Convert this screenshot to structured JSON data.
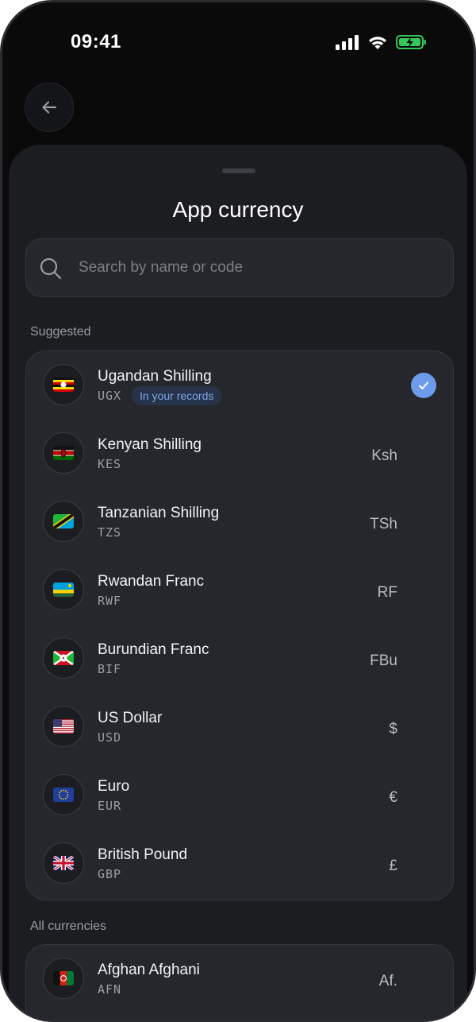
{
  "status_bar": {
    "time": "09:41"
  },
  "sheet": {
    "title": "App currency",
    "search": {
      "placeholder": "Search by name or code",
      "value": ""
    }
  },
  "sections": {
    "suggested_label": "Suggested",
    "all_label": "All currencies"
  },
  "suggested": [
    {
      "name": "Ugandan Shilling",
      "code": "UGX",
      "badge": "In your records",
      "selected": true,
      "flag": "uganda-flag-icon"
    },
    {
      "name": "Kenyan Shilling",
      "code": "KES",
      "symbol": "Ksh",
      "flag": "kenya-flag-icon"
    },
    {
      "name": "Tanzanian Shilling",
      "code": "TZS",
      "symbol": "TSh",
      "flag": "tanzania-flag-icon"
    },
    {
      "name": "Rwandan Franc",
      "code": "RWF",
      "symbol": "RF",
      "flag": "rwanda-flag-icon"
    },
    {
      "name": "Burundian Franc",
      "code": "BIF",
      "symbol": "FBu",
      "flag": "burundi-flag-icon"
    },
    {
      "name": "US Dollar",
      "code": "USD",
      "symbol": "$",
      "flag": "usa-flag-icon"
    },
    {
      "name": "Euro",
      "code": "EUR",
      "symbol": "€",
      "flag": "eu-flag-icon"
    },
    {
      "name": "British Pound",
      "code": "GBP",
      "symbol": "£",
      "flag": "uk-flag-icon"
    }
  ],
  "all_currencies": [
    {
      "name": "Afghan Afghani",
      "code": "AFN",
      "symbol": "Af.",
      "flag": "afghanistan-flag-icon"
    }
  ],
  "colors": {
    "background": "#0a0a0b",
    "sheet": "#1c1d21",
    "card": "#26272c",
    "accent": "#6b9bea",
    "battery": "#34c759"
  }
}
